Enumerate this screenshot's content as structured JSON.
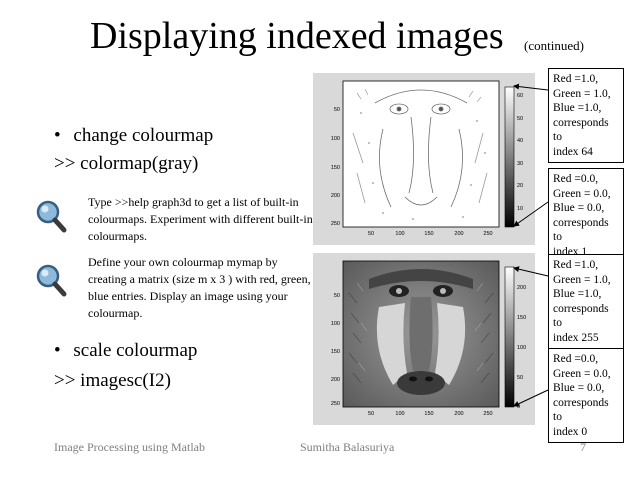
{
  "slide": {
    "title": "Displaying indexed images",
    "title_sub": "(continued)",
    "bullet1": "change colourmap",
    "cmd1": ">> colormap(gray)",
    "note1": "Type >>help graph3d to get a list of built-in colourmaps. Experiment with different built-in colourmaps.",
    "note2": "Define your own colourmap mymap by creating a matrix (size m x 3 ) with red, green, blue entries. Display an image using your colourmap.",
    "bullet2": "scale colourmap",
    "cmd2": ">> imagesc(I2)",
    "bullet_char": "•",
    "icons": [
      "magnifier-icon",
      "magnifier-icon"
    ]
  },
  "figure1": {
    "xticks": [
      "50",
      "100",
      "150",
      "200",
      "250"
    ],
    "yticks": [
      "50",
      "100",
      "150",
      "200",
      "250"
    ],
    "cbar_ticks": [
      "60",
      "50",
      "40",
      "30",
      "20",
      "10"
    ]
  },
  "figure2": {
    "xticks": [
      "50",
      "100",
      "150",
      "200",
      "250"
    ],
    "yticks": [
      "50",
      "100",
      "150",
      "200",
      "250"
    ],
    "cbar_ticks": [
      "200",
      "150",
      "100",
      "50",
      "0"
    ]
  },
  "callouts": {
    "c1": {
      "l1": "Red =1.0,",
      "l2": "Green = 1.0,",
      "l3": "Blue =1.0,",
      "l4": "corresponds to",
      "l5": "index 64"
    },
    "c2": {
      "l1": "Red =0.0,",
      "l2": "Green = 0.0,",
      "l3": "Blue = 0.0,",
      "l4": "corresponds to",
      "l5": "index 1"
    },
    "c3": {
      "l1": "Red =1.0,",
      "l2": "Green = 1.0,",
      "l3": "Blue =1.0,",
      "l4": "corresponds to",
      "l5": "index 255"
    },
    "c4": {
      "l1": "Red =0.0,",
      "l2": "Green = 0.0,",
      "l3": "Blue = 0.0,",
      "l4": "corresponds to",
      "l5": "index 0"
    }
  },
  "footer": {
    "left": "Image Processing using Matlab",
    "center": "Sumitha Balasuriya",
    "page": "7"
  },
  "colors": {
    "figure_bg": "#d9d9d9",
    "footer_text": "#7f7f7f",
    "icon_lens": "#6fa0c8"
  }
}
